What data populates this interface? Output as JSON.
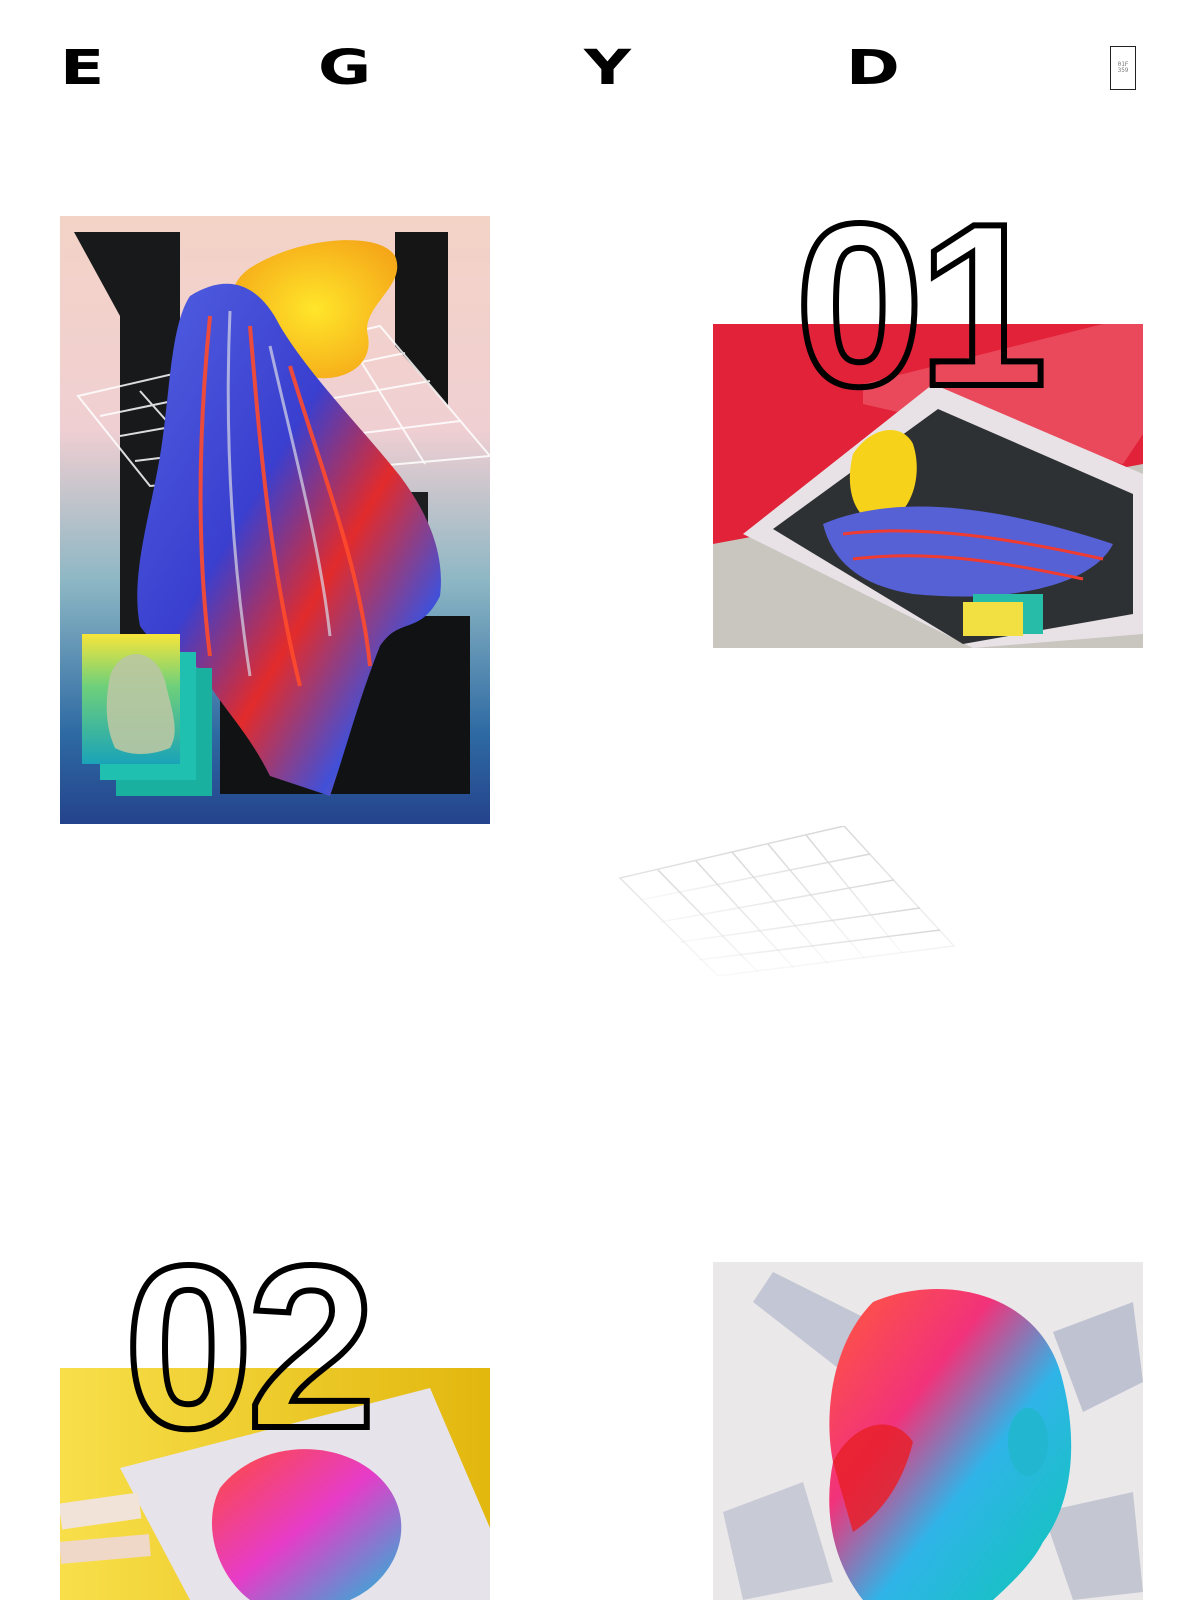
{
  "header": {
    "logo_letters": [
      "E",
      "G",
      "Y",
      "D"
    ],
    "menu_label": "01F 359"
  },
  "projects": [
    {
      "number": "01"
    },
    {
      "number": "02"
    }
  ],
  "colors": {
    "background": "#ffffff",
    "red": "#e2283a",
    "yellow": "#f5cf1f",
    "blue": "#3a4fd8",
    "ink": "#000000"
  },
  "icons": [
    "menu-icon",
    "grid-plane-icon"
  ]
}
